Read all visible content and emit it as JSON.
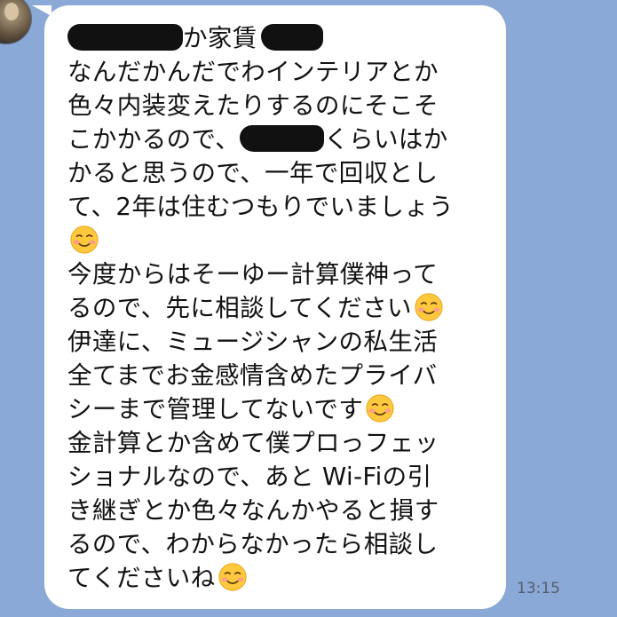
{
  "chat": {
    "message": {
      "lines": [
        "か家賃",
        "なんだかんだでわインテリアとか",
        "色々内装変えたりするのにそこそ",
        "こかかるので、",
        "くらいはか",
        "かると思うので、一年で回収とし",
        "て、2年は住むつもりでいましょう",
        "今度からはそーゆー計算僕神って",
        "るので、先に相談してください",
        "伊達に、ミュージシャンの私生活",
        "全てまでお金感情含めたプライバ",
        "シーまで管理してないです",
        "金計算とか含めて僕プロっフェッ",
        "ショナルなので、あと Wi-Fiの引",
        "き継ぎとか色々なんかやると損す",
        "るので、わからなかったら相談し",
        "てくださいね"
      ],
      "emoji": "smiling-face-emoji",
      "time": "13:15"
    }
  }
}
